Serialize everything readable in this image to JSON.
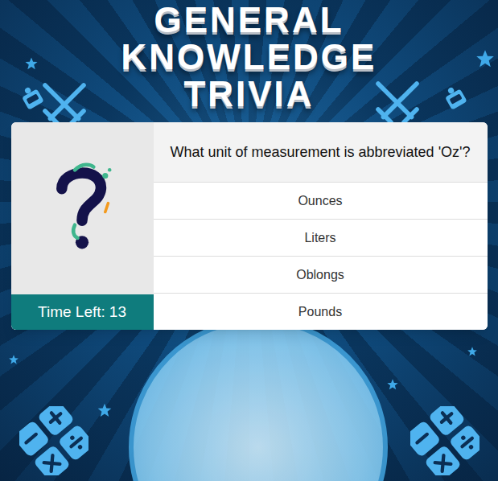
{
  "title": {
    "lines": [
      "GENERAL",
      "KNOWLEDGE",
      "TRIVIA"
    ]
  },
  "question": {
    "text": "What unit of measurement is abbreviated 'Oz'?"
  },
  "answers": [
    {
      "label": "Ounces",
      "selected": false
    },
    {
      "label": "Liters",
      "selected": false
    },
    {
      "label": "Oblongs",
      "selected": false
    },
    {
      "label": "Pounds",
      "selected": false
    }
  ],
  "timer": {
    "label": "Time Left:",
    "value": "13"
  }
}
